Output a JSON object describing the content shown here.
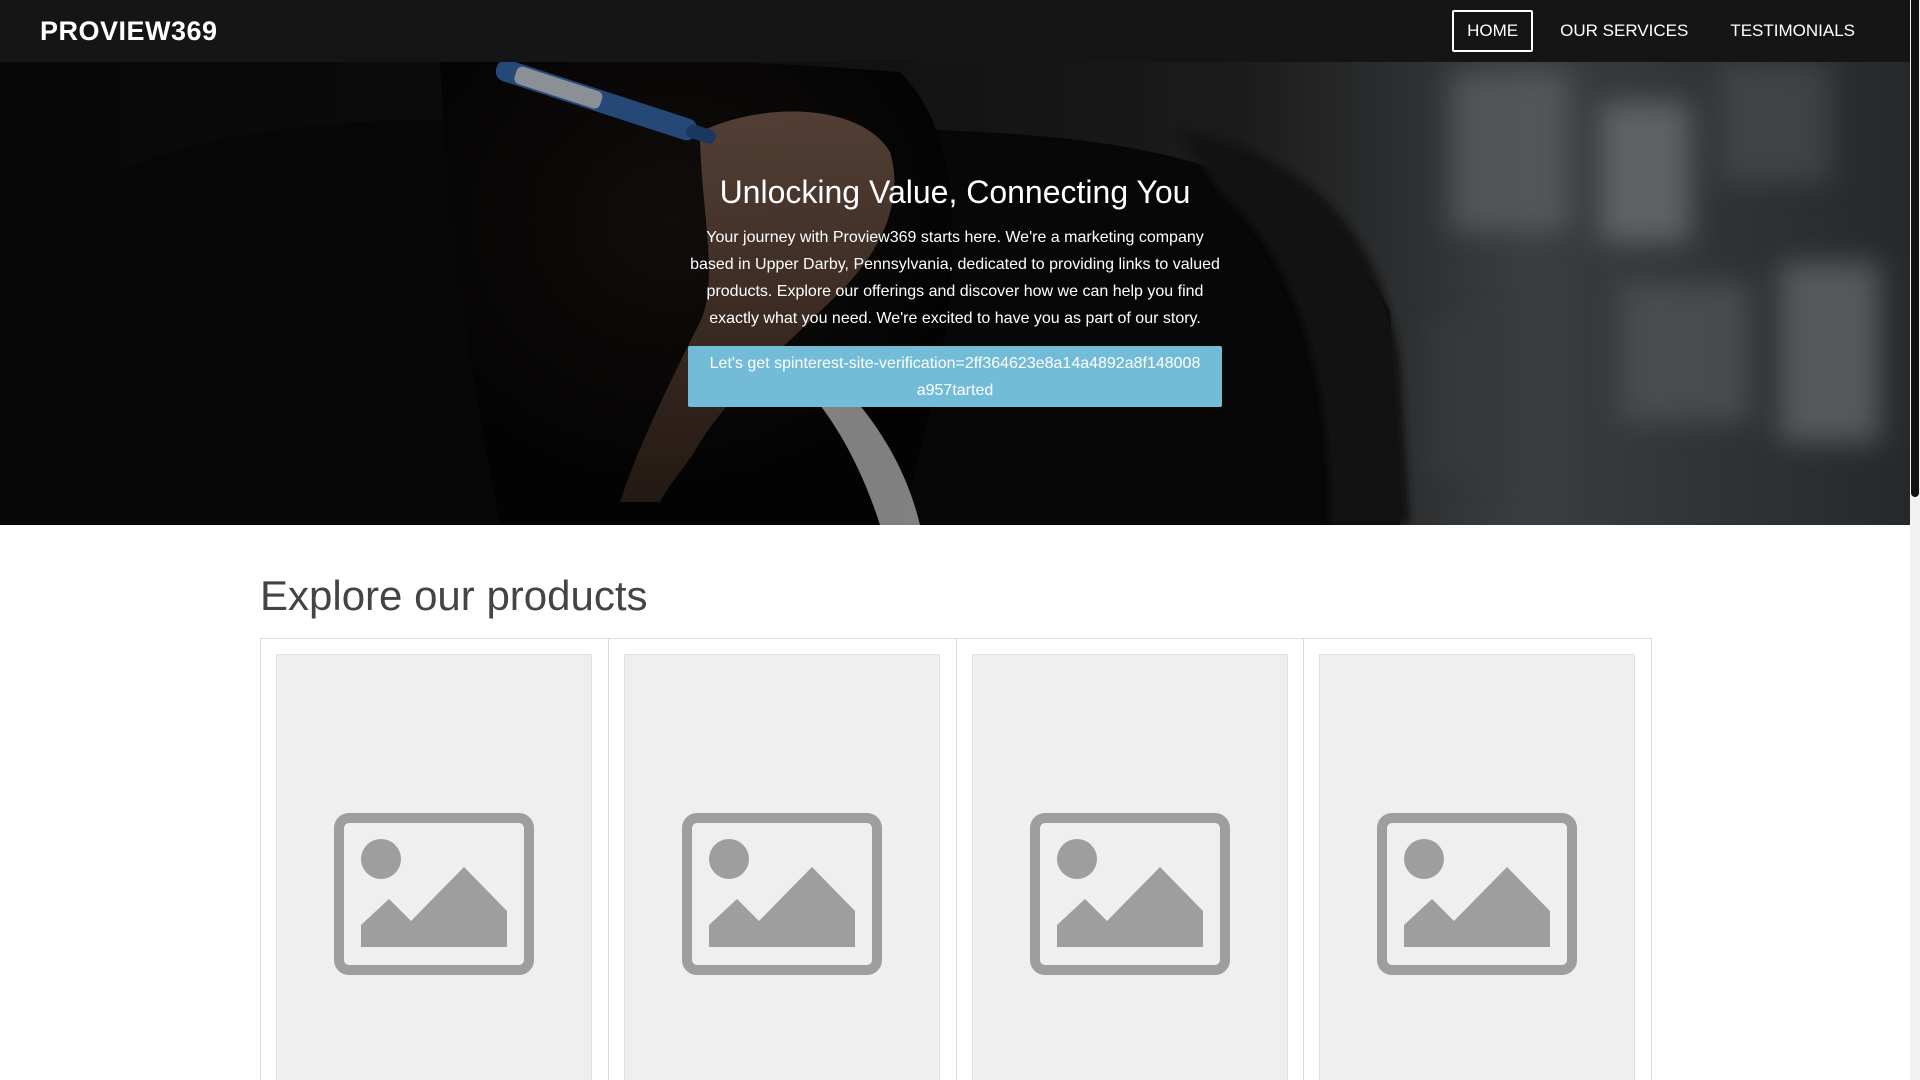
{
  "header": {
    "brand": "PROVIEW369",
    "nav": [
      {
        "label": "HOME",
        "active": true
      },
      {
        "label": "OUR SERVICES",
        "active": false
      },
      {
        "label": "TESTIMONIALS",
        "active": false
      }
    ]
  },
  "hero": {
    "title": "Unlocking Value, Connecting You",
    "text": "Your journey with Proview369 starts here. We're a marketing company based in Upper Darby, Pennsylvania, dedicated to providing links to valued products. Explore our offerings and discover how we can help you find exactly what you need. We're excited to have you as part of our story.",
    "button_label": "Let's get spinterest-site-verification=2ff364623e8a14a4892a8f148008a957tarted"
  },
  "products": {
    "title": "Explore our products",
    "items": [
      {
        "image_icon": "image-placeholder-icon"
      },
      {
        "image_icon": "image-placeholder-icon"
      },
      {
        "image_icon": "image-placeholder-icon"
      },
      {
        "image_icon": "image-placeholder-icon"
      }
    ]
  },
  "colors": {
    "navbar_bg": "#151515",
    "button_bg": "#72bcd8",
    "placeholder_bg": "#efefef",
    "placeholder_icon": "#9e9e9e"
  }
}
